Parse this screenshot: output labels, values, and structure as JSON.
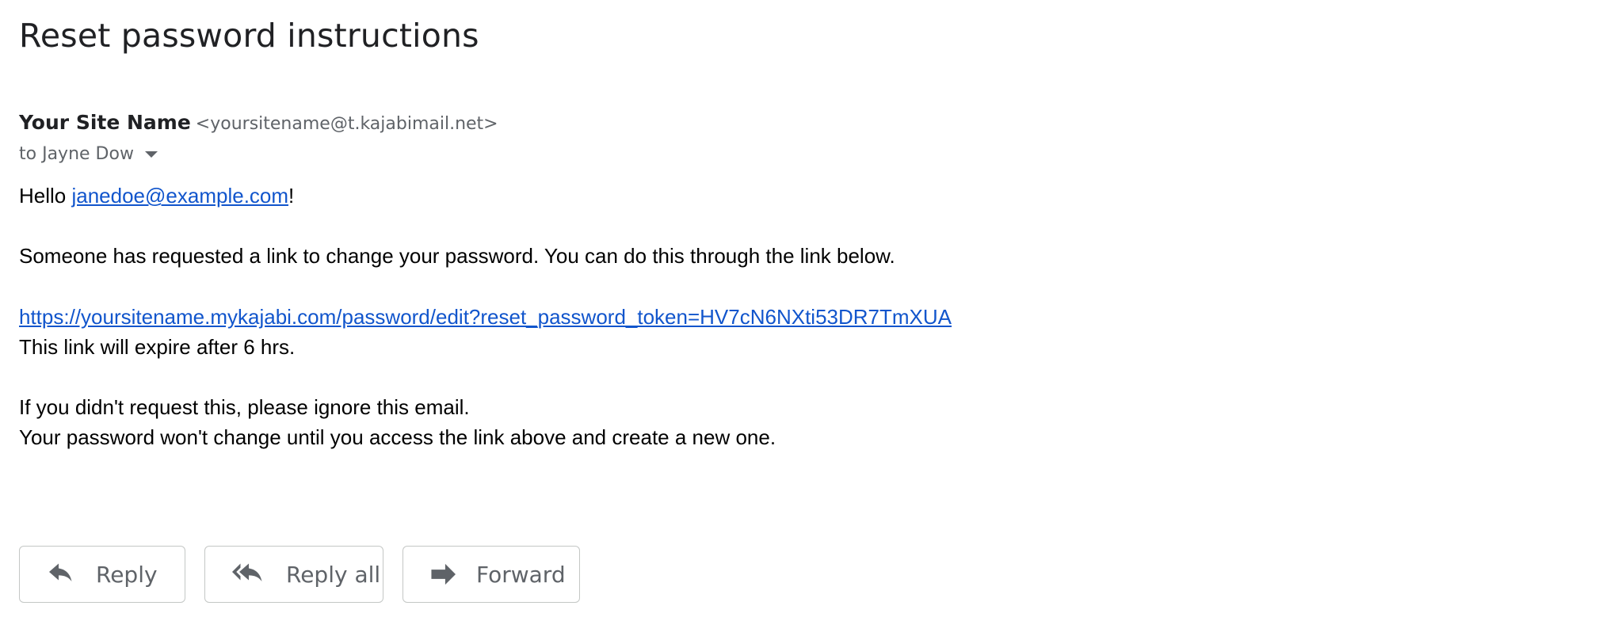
{
  "email": {
    "subject": "Reset password instructions",
    "sender": {
      "name": "Your Site Name",
      "address": "<yoursitename@t.kajabimail.net>"
    },
    "recipient_line": "to Jayne Dow",
    "body": {
      "greeting_prefix": "Hello ",
      "greeting_email": "janedoe@example.com",
      "greeting_suffix": "!",
      "request_line": "Someone has requested a link to change your password. You can do this through the link below.",
      "reset_link": "https://yoursitename.mykajabi.com/password/edit?reset_password_token=HV7cN6NXti53DR7TmXUA",
      "expiry_line": "This link will expire after 6 hrs.",
      "ignore_line": "If you didn't request this, please ignore this email.",
      "no_change_line": "Your password won't change until you access the link above and create a new one."
    }
  },
  "actions": {
    "reply": {
      "label": "Reply",
      "icon": "reply-icon"
    },
    "reply_all": {
      "label": "Reply all",
      "icon": "reply-all-icon"
    },
    "forward": {
      "label": "Forward",
      "icon": "forward-icon"
    }
  },
  "colors": {
    "link": "#1155cc",
    "text": "#202124",
    "muted": "#5f6368",
    "button_border": "#c4c7c5"
  }
}
